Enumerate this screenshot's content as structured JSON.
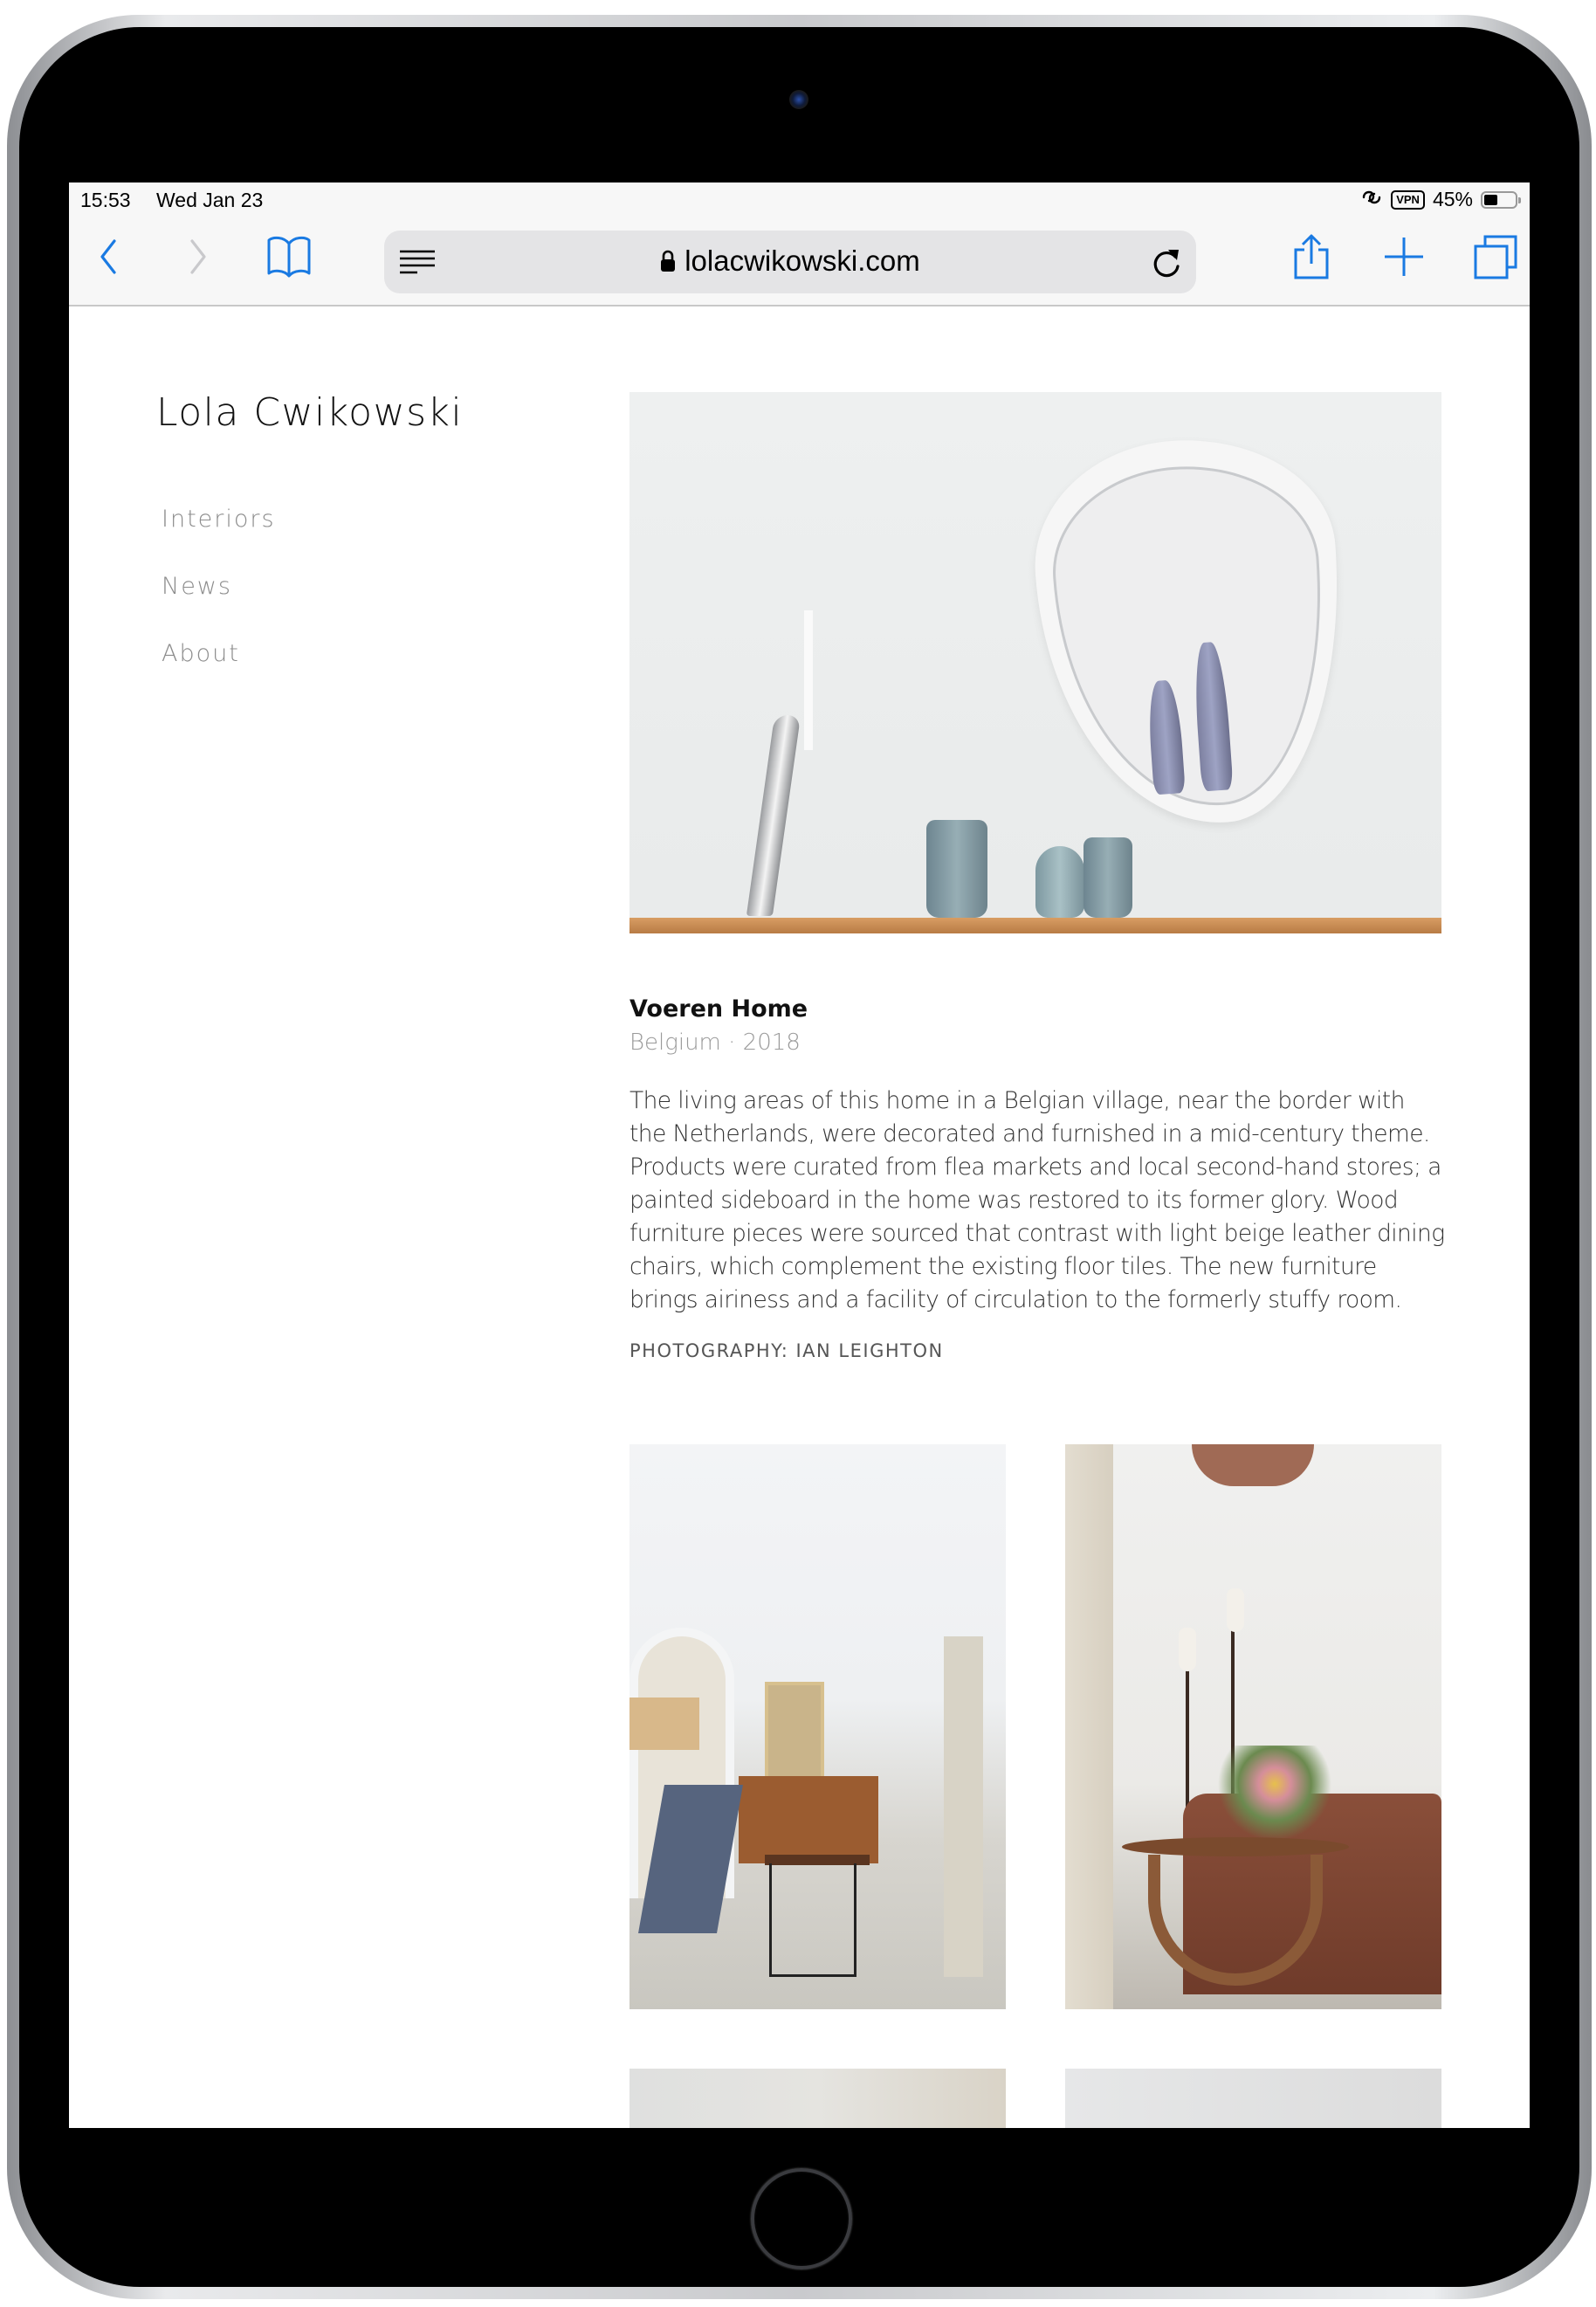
{
  "status_bar": {
    "time": "15:53",
    "date": "Wed Jan 23",
    "vpn_label": "VPN",
    "battery_percent": "45%",
    "battery_level": 0.45,
    "icons": [
      "link-icon",
      "vpn-badge",
      "battery-icon"
    ]
  },
  "browser": {
    "url": "lolacwikowski.com",
    "secure": true,
    "icons": {
      "back": "chevron-left-icon",
      "forward": "chevron-right-icon",
      "bookmarks": "book-icon",
      "reader": "reader-mode-icon",
      "reload": "reload-icon",
      "share": "share-icon",
      "new_tab": "plus-icon",
      "tabs": "tabs-icon"
    },
    "accent_color": "#1a7ae2"
  },
  "site": {
    "title": "Lola Cwikowski",
    "nav": [
      {
        "label": "Interiors"
      },
      {
        "label": "News"
      },
      {
        "label": "About"
      }
    ]
  },
  "project": {
    "title": "Voeren Home",
    "location_year": "Belgium · 2018",
    "description": "The living areas of this home in a Belgian village, near the border with the Netherlands, were decorated and furnished in a mid-century theme. Products were curated from flea markets and local second-hand stores; a painted sideboard in the home was restored to its former glory. Wood furniture pieces were sourced that contrast with light beige leather dining chairs, which complement the existing floor tiles. The new furniture brings airiness and a facility of circulation to the formerly stuffy room.",
    "credit": "PHOTOGRAPHY: IAN LEIGHTON",
    "images": [
      {
        "alt": "Wall mirror above shelf with ceramic jugs and silver candle holder"
      },
      {
        "alt": "Living room with armchair, nesting tables and sideboard"
      },
      {
        "alt": "Leather sofa with round wooden coffee table and flowers"
      },
      {
        "alt": "Interior photo (partially visible)"
      },
      {
        "alt": "Interior photo (partially visible)"
      }
    ]
  }
}
